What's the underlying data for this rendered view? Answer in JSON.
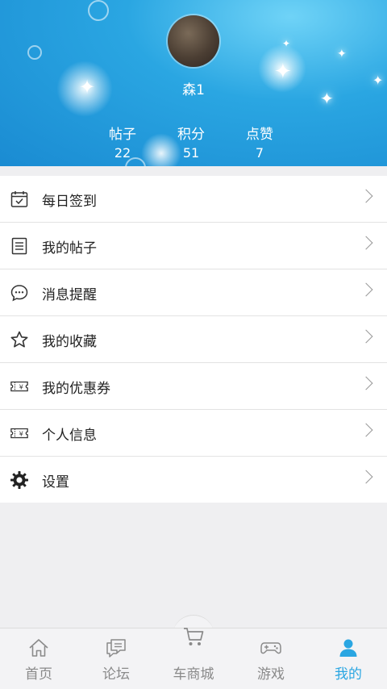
{
  "profile": {
    "username": "森1",
    "stats": [
      {
        "label": "帖子",
        "value": "22"
      },
      {
        "label": "积分",
        "value": "51"
      },
      {
        "label": "点赞",
        "value": "7"
      }
    ]
  },
  "menu": {
    "items": [
      {
        "label": "每日签到",
        "icon": "calendar-check-icon"
      },
      {
        "label": "我的帖子",
        "icon": "document-icon"
      },
      {
        "label": "消息提醒",
        "icon": "chat-bubble-icon"
      },
      {
        "label": "我的收藏",
        "icon": "star-icon"
      },
      {
        "label": "我的优惠券",
        "icon": "coupon-icon"
      },
      {
        "label": "个人信息",
        "icon": "coupon-icon"
      },
      {
        "label": "设置",
        "icon": "gear-icon"
      }
    ]
  },
  "tabbar": {
    "tabs": [
      {
        "label": "首页",
        "icon": "home-icon"
      },
      {
        "label": "论坛",
        "icon": "forum-icon"
      },
      {
        "label": "车商城",
        "icon": "cart-icon"
      },
      {
        "label": "游戏",
        "icon": "gamepad-icon"
      },
      {
        "label": "我的",
        "icon": "user-icon"
      }
    ],
    "active_index": 4
  },
  "colors": {
    "accent": "#2aa6e2",
    "tab_inactive": "#8a8a8a",
    "header_blue": "#1a8bd2"
  }
}
